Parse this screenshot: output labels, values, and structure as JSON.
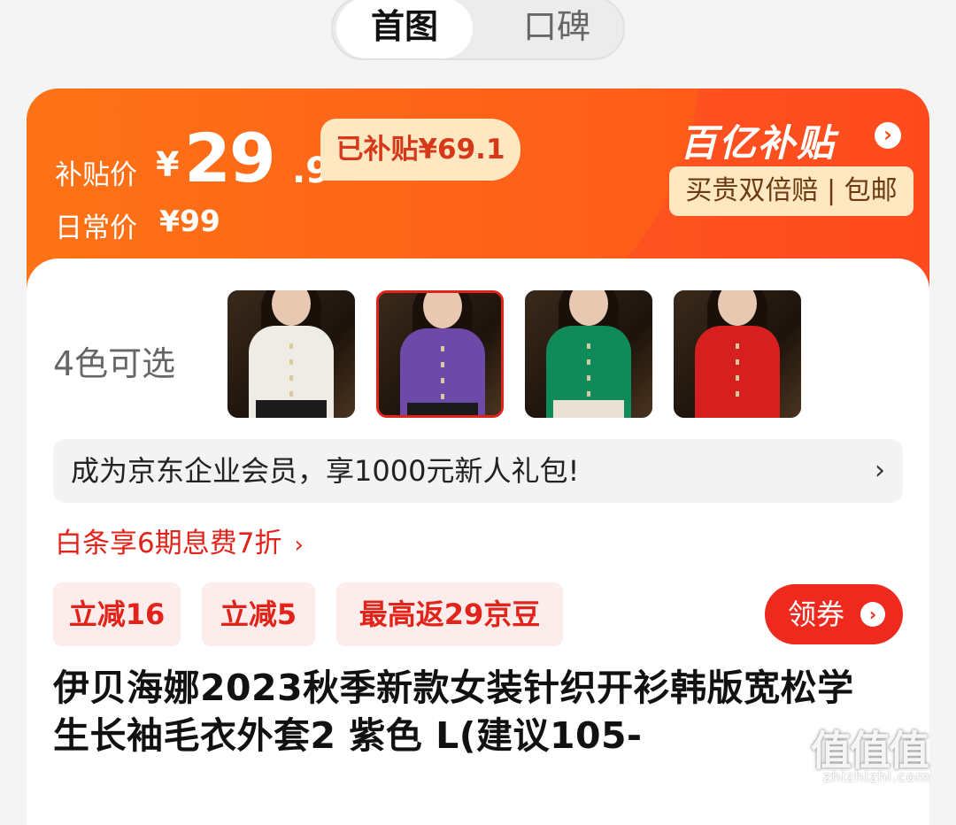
{
  "tabs": [
    {
      "label": "首图",
      "active": true
    },
    {
      "label": "口碑",
      "active": false
    }
  ],
  "price": {
    "subsidy_label": "补贴价",
    "currency": "¥",
    "subsidy_int": "29",
    "subsidy_dec": ".9",
    "saved_text": "已补贴¥69.1",
    "daily_label": "日常价",
    "daily_price": "¥99",
    "brand_name": "百亿补贴",
    "guarantee_text": "买贵双倍赔 | 包邮"
  },
  "variants": {
    "label": "4色可选",
    "items": [
      {
        "color_name": "white",
        "swatch": "#efece6",
        "selected": false
      },
      {
        "color_name": "purple",
        "swatch": "#6d4aa8",
        "selected": true
      },
      {
        "color_name": "green",
        "swatch": "#0f8a5a",
        "selected": false
      },
      {
        "color_name": "red",
        "swatch": "#d61f1f",
        "selected": false
      }
    ]
  },
  "promo_bar": {
    "text": "成为京东企业会员，享1000元新人礼包!",
    "arrow": "›"
  },
  "baitiao": {
    "text": "白条享6期息费7折",
    "arrow": "›"
  },
  "coupons": [
    "立减16",
    "立减5",
    "最高返29京豆"
  ],
  "get_coupon": {
    "label": "领券",
    "arrow": "›"
  },
  "product_title": "伊贝海娜2023秋季新款女装针织开衫韩版宽松学生长袖毛衣外套2 紫色 L(建议105-",
  "watermark": {
    "big": "值值值",
    "small": "zhizhizhi.com"
  },
  "colors": {
    "accent": "#e2231a",
    "banner_orange": "#fd5720",
    "coupon_bg": "#fdecec",
    "gold_bg": "#ffe7c2"
  }
}
